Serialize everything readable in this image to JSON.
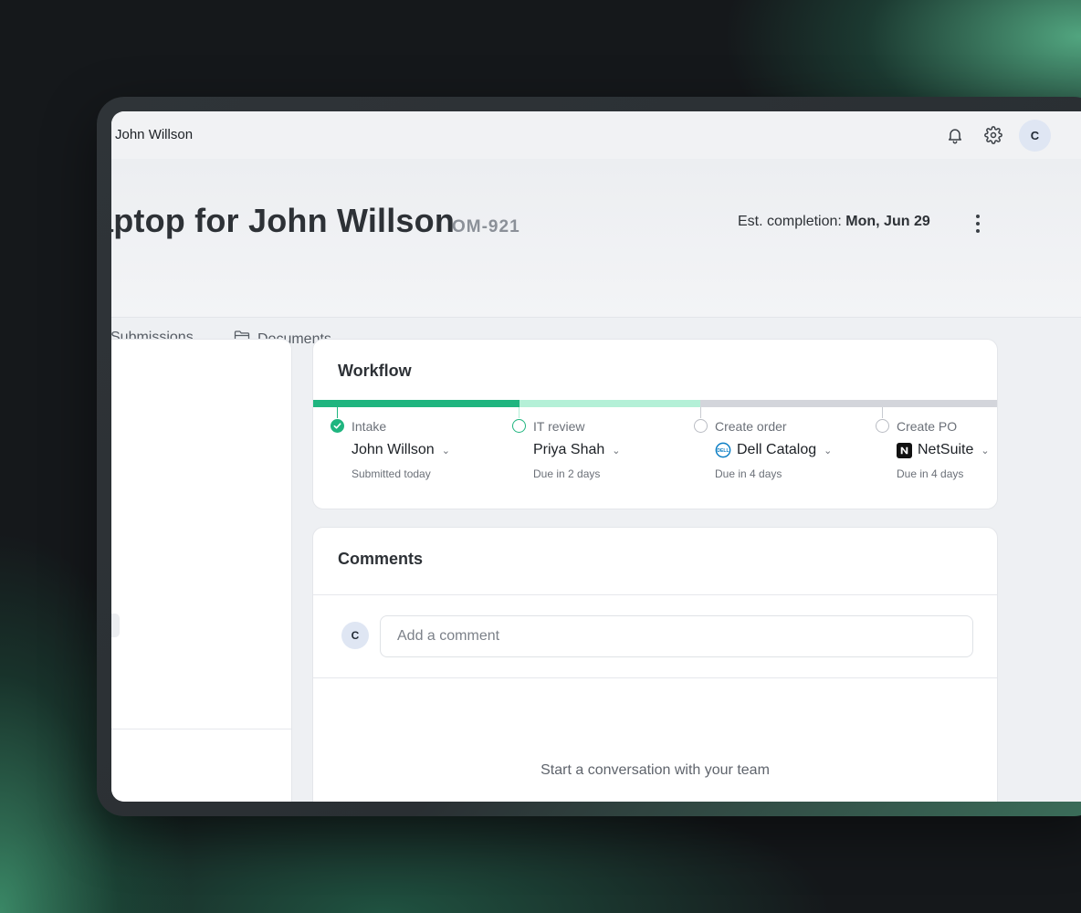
{
  "topbar": {
    "breadcrumb": "John Willson",
    "avatar_initial": "C"
  },
  "header": {
    "title": "aptop for John Willson",
    "ticket_id": "OM-921",
    "est_label": "Est. completion:",
    "est_value": "Mon, Jun 29"
  },
  "tabs": [
    {
      "label": "Submissions"
    },
    {
      "label": "Documents"
    }
  ],
  "workflow": {
    "title": "Workflow",
    "progress_colors": [
      "#1fb57f",
      "#b4f0d7",
      "#d3d5db"
    ],
    "stages": [
      {
        "label": "Intake",
        "owner": "John Willson",
        "due": "Submitted today",
        "status": "done",
        "icon": "check-circle-icon"
      },
      {
        "label": "IT review",
        "owner": "Priya Shah",
        "due": "Due in 2 days",
        "status": "active",
        "icon": "circle-icon"
      },
      {
        "label": "Create order",
        "owner": "Dell Catalog",
        "due": "Due in 4 days",
        "status": "pending",
        "icon": "dell-logo-icon"
      },
      {
        "label": "Create PO",
        "owner": "NetSuite",
        "due": "Due in 4 days",
        "status": "pending",
        "icon": "netsuite-logo-icon"
      }
    ]
  },
  "comments": {
    "title": "Comments",
    "avatar_initial": "C",
    "input_placeholder": "Add a comment",
    "empty_text": "Start a conversation with your team"
  },
  "colors": {
    "accent": "#1fb57f",
    "accent_light": "#b4f0d7",
    "neutral": "#d3d5db"
  }
}
